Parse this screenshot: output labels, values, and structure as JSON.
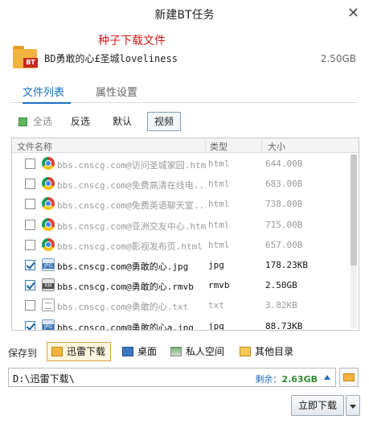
{
  "window": {
    "title": "新建BT任务",
    "close_glyph": "✕"
  },
  "torrent": {
    "annotation": "种子下载文件",
    "icon_badge": "BT",
    "name": "BD勇敢的心£圣城loveliness",
    "size": "2.50GB"
  },
  "tabs": [
    {
      "label": "文件列表",
      "active": true
    },
    {
      "label": "属性设置",
      "active": false
    }
  ],
  "filters": {
    "all": "全选",
    "reverse": "反选",
    "default": "默认",
    "video": "视频"
  },
  "list": {
    "headers": {
      "name": "文件名称",
      "type": "类型",
      "size": "大小"
    },
    "rows": [
      {
        "checked": false,
        "icon": "chrome-icon",
        "name": "bbs.cnscg.com@访问圣城家园.html",
        "type": "html",
        "size": "644.00B"
      },
      {
        "checked": false,
        "icon": "chrome-icon",
        "name": "bbs.cnscg.com@免费高清在线电...",
        "type": "html",
        "size": "683.00B"
      },
      {
        "checked": false,
        "icon": "chrome-icon",
        "name": "bbs.cnscg.com@免费英语聊天室...",
        "type": "html",
        "size": "738.00B"
      },
      {
        "checked": false,
        "icon": "chrome-icon",
        "name": "bbs.cnscg.com@亚洲交友中心.html",
        "type": "html",
        "size": "715.00B"
      },
      {
        "checked": false,
        "icon": "chrome-icon",
        "name": "bbs.cnscg.com@影视发布页.html",
        "type": "html",
        "size": "657.00B"
      },
      {
        "checked": true,
        "icon": "jpg-file-icon",
        "name": "bbs.cnscg.com@勇敢的心.jpg",
        "type": "jpg",
        "size": "178.23KB"
      },
      {
        "checked": true,
        "icon": "rmvb-file-icon",
        "name": "bbs.cnscg.com@勇敢的心.rmvb",
        "type": "rmvb",
        "size": "2.50GB"
      },
      {
        "checked": false,
        "icon": "txt-file-icon",
        "name": "bbs.cnscg.com@勇敢的心.txt",
        "type": "txt",
        "size": "3.82KB"
      },
      {
        "checked": true,
        "icon": "jpg-file-icon",
        "name": "bbs.cnscg.com@勇敢的心a.jpg",
        "type": "jpg",
        "size": "88.73KB"
      }
    ]
  },
  "saveto": {
    "label": "保存到",
    "options": {
      "xunlei": "迅雷下载",
      "desktop": "桌面",
      "private": "私人空间",
      "other": "其他目录"
    }
  },
  "path": {
    "value": "D:\\迅雷下载\\",
    "remain_label": "剩余：",
    "remain_value": "2.63GB"
  },
  "actions": {
    "download": "立即下载"
  },
  "colors": {
    "accent": "#1a6fc1",
    "annotation": "#d11a1a",
    "remain": "#2e8b2e"
  }
}
